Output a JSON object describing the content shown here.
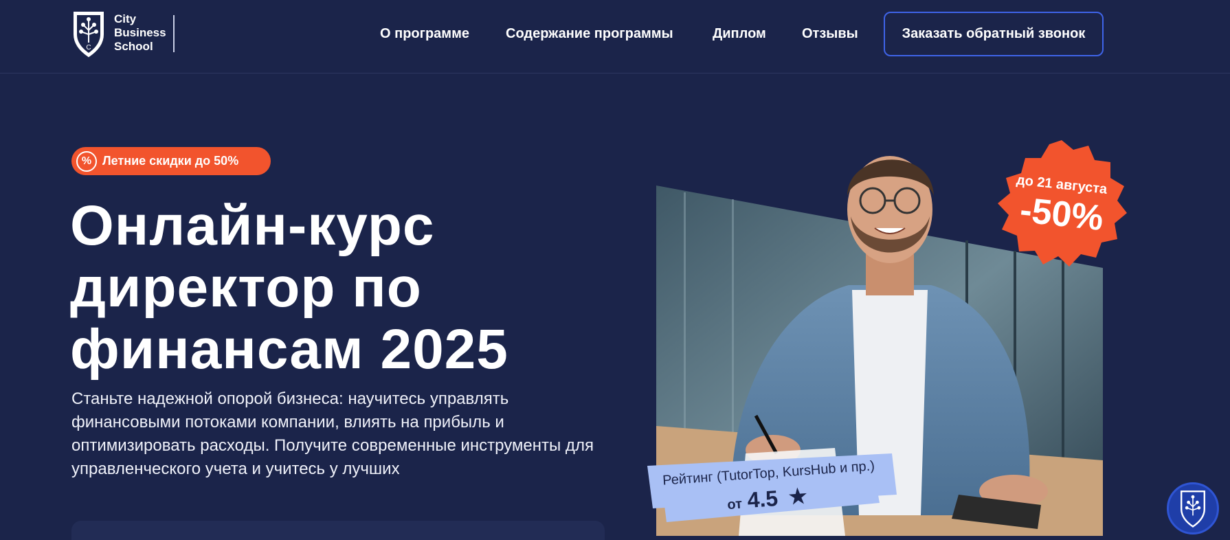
{
  "header": {
    "logo": {
      "line1": "City",
      "line2": "Business",
      "line3": "School",
      "shield_letter": "C"
    },
    "nav": [
      {
        "label": "О программе"
      },
      {
        "label": "Содержание программы"
      },
      {
        "label": "Диплом"
      },
      {
        "label": "Отзывы"
      }
    ],
    "cta_label": "Заказать обратный звонок"
  },
  "hero": {
    "badge_icon": "%",
    "badge_text": "Летние скидки до 50%",
    "title_line1": "Онлайн-курс",
    "title_line2": "директор по",
    "title_line3": "финансам 2025",
    "subtitle": "Станьте надежной опорой бизнеса: научитесь управлять финансовыми потоками компании, влиять на прибыль и оптимизировать расходы. Получите современные инструменты для управленческого учета и учитесь у лучших"
  },
  "promo": {
    "date_text": "до 21 августа",
    "discount_text": "-50%"
  },
  "rating": {
    "label": "Рейтинг (TutorTop, KursHub и пр.)",
    "prefix": "от",
    "value": "4.5",
    "star": "★"
  },
  "colors": {
    "background": "#1b244a",
    "accent_orange": "#f2542d",
    "accent_blue": "#3f64e8",
    "rating_bg": "#a9c0f5"
  },
  "icons": {
    "logo": "shield-tree-icon",
    "badge": "percent-icon",
    "rating": "star-icon",
    "chat": "shield-tree-icon"
  }
}
